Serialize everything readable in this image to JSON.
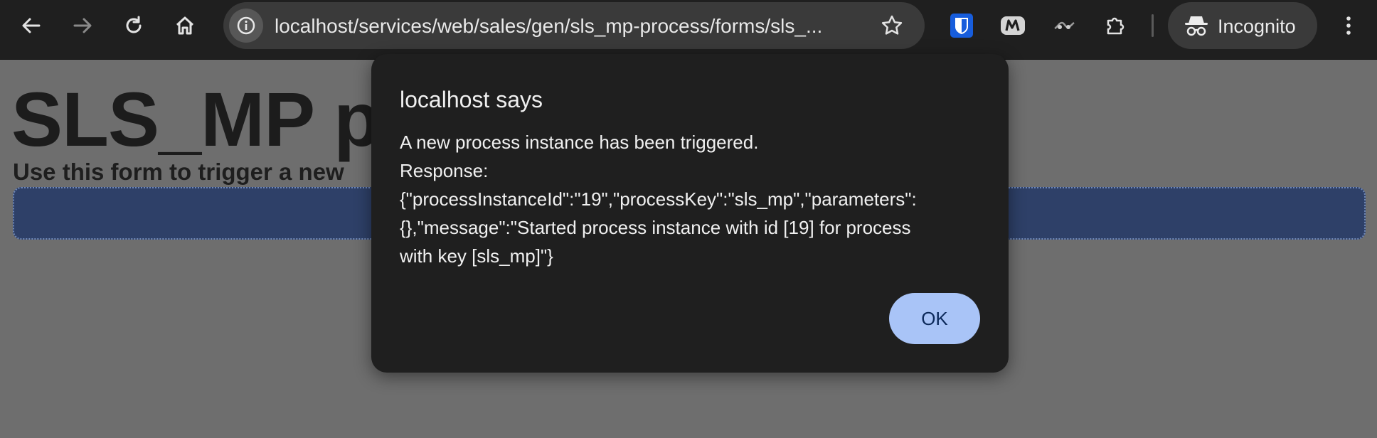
{
  "browser": {
    "url": "localhost/services/web/sales/gen/sls_mp-process/forms/sls_...",
    "incognito_label": "Incognito"
  },
  "page": {
    "title": "SLS_MP p",
    "subtitle": "Use this form to trigger a new"
  },
  "dialog": {
    "title": "localhost says",
    "message_lines": [
      "A new process instance has been triggered.",
      "Response:",
      "{\"processInstanceId\":\"19\",\"processKey\":\"sls_mp\",\"parameters\":",
      "{},\"message\":\"Started process instance with id [19] for process",
      "with key [sls_mp]\"}"
    ],
    "ok_label": "OK"
  }
}
